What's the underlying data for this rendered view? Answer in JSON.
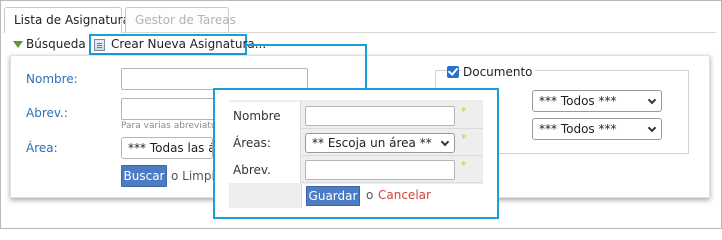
{
  "tabs": [
    {
      "label": "Lista de Asignaturas",
      "active": true
    },
    {
      "label": "Gestor de Tareas",
      "active": false
    }
  ],
  "toolbar": {
    "search_label": "Búsqueda",
    "create_label": "Crear Nueva Asignatura..."
  },
  "search": {
    "nombre_label": "Nombre:",
    "abrev_label": "Abrev.:",
    "abrev_hint": "Para varias abreviatu",
    "area_label": "Área:",
    "area_value": "*** Todas las áre",
    "search_button": "Buscar",
    "clear_text": "o Limpi",
    "documento_label": "Documento",
    "documento_checked": true,
    "dropdown1_value": "*** Todos ***",
    "dropdown2_value": "*** Todos ***"
  },
  "popup": {
    "nombre_label": "Nombre",
    "areas_label": "Áreas:",
    "areas_value": "** Escoja un área **",
    "abrev_label": "Abrev.",
    "required_mark": "*",
    "save_button": "Guardar",
    "or_text": "o",
    "cancel_link": "Cancelar"
  },
  "colors": {
    "highlight": "#1aa0d9",
    "primary_button": "#4b7cc4",
    "label_blue": "#2c6fb7",
    "cancel_red": "#d9443a",
    "required_star": "#e8c300"
  }
}
